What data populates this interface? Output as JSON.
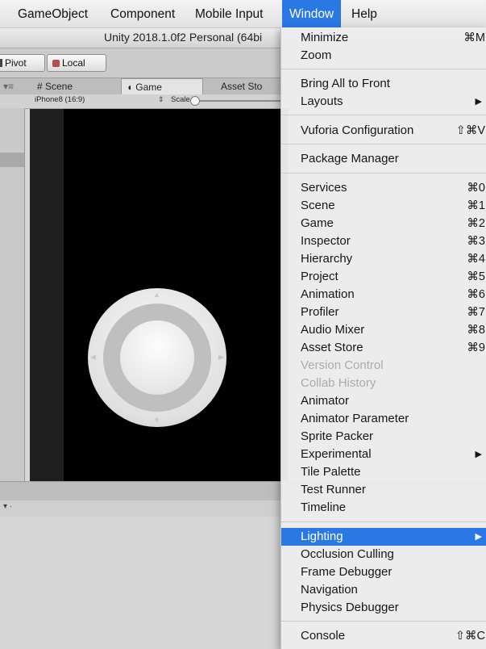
{
  "menubar": {
    "items": [
      "GameObject",
      "Component",
      "Mobile Input",
      "Window",
      "Help"
    ]
  },
  "editor": {
    "title": "Unity 2018.1.0f2 Personal (64bi",
    "toolbar": {
      "pivot": "Pivot",
      "local": "Local"
    },
    "tabs": {
      "scene": "# Scene",
      "game": "Game",
      "asset_store": "Asset Sto"
    },
    "game_controls": {
      "resolution": "iPhone8 (16:9)",
      "scale_label": "Scale"
    }
  },
  "window_menu": {
    "items": [
      {
        "label": "Minimize",
        "shortcut": "⌘M"
      },
      {
        "label": "Zoom",
        "shortcut": ""
      },
      {
        "label": "Bring All to Front",
        "shortcut": ""
      },
      {
        "label": "Layouts",
        "shortcut": "▶"
      },
      {
        "label": "Vuforia Configuration",
        "shortcut": "⇧⌘V"
      },
      {
        "label": "Package Manager",
        "shortcut": ""
      },
      {
        "label": "Services",
        "shortcut": "⌘0"
      },
      {
        "label": "Scene",
        "shortcut": "⌘1"
      },
      {
        "label": "Game",
        "shortcut": "⌘2"
      },
      {
        "label": "Inspector",
        "shortcut": "⌘3"
      },
      {
        "label": "Hierarchy",
        "shortcut": "⌘4"
      },
      {
        "label": "Project",
        "shortcut": "⌘5"
      },
      {
        "label": "Animation",
        "shortcut": "⌘6"
      },
      {
        "label": "Profiler",
        "shortcut": "⌘7"
      },
      {
        "label": "Audio Mixer",
        "shortcut": "⌘8"
      },
      {
        "label": "Asset Store",
        "shortcut": "⌘9"
      },
      {
        "label": "Version Control",
        "shortcut": "",
        "disabled": true
      },
      {
        "label": "Collab History",
        "shortcut": "",
        "disabled": true
      },
      {
        "label": "Animator",
        "shortcut": ""
      },
      {
        "label": "Animator Parameter",
        "shortcut": ""
      },
      {
        "label": "Sprite Packer",
        "shortcut": ""
      },
      {
        "label": "Experimental",
        "shortcut": "▶"
      },
      {
        "label": "Tile Palette",
        "shortcut": ""
      },
      {
        "label": "Test Runner",
        "shortcut": ""
      },
      {
        "label": "Timeline",
        "shortcut": ""
      },
      {
        "label": "Lighting",
        "shortcut": "▶",
        "highlighted": true
      },
      {
        "label": "Occlusion Culling",
        "shortcut": ""
      },
      {
        "label": "Frame Debugger",
        "shortcut": ""
      },
      {
        "label": "Navigation",
        "shortcut": ""
      },
      {
        "label": "Physics Debugger",
        "shortcut": ""
      },
      {
        "label": "Console",
        "shortcut": "⇧⌘C"
      }
    ]
  },
  "colors": {
    "highlight": "#2a78e4",
    "disabled_text": "#ababab"
  }
}
